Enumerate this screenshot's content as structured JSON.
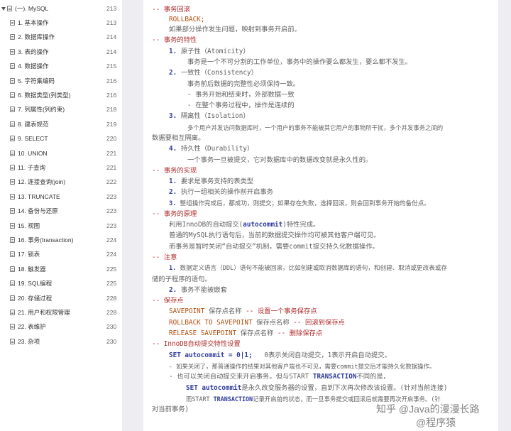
{
  "toc": {
    "root": {
      "label": "(一). MySQL",
      "page": "213"
    },
    "items": [
      {
        "label": "1. 基本操作",
        "page": "213"
      },
      {
        "label": "2. 数据库操作",
        "page": "214"
      },
      {
        "label": "3. 表的操作",
        "page": "214"
      },
      {
        "label": "4. 数据操作",
        "page": "215"
      },
      {
        "label": "5. 字符集编码",
        "page": "216"
      },
      {
        "label": "6. 数据类型(列类型)",
        "page": "216"
      },
      {
        "label": "7. 列属性(列约束)",
        "page": "218"
      },
      {
        "label": "8. 建表规范",
        "page": "219"
      },
      {
        "label": "9. SELECT",
        "page": "220"
      },
      {
        "label": "10. UNION",
        "page": "221"
      },
      {
        "label": "11. 子查询",
        "page": "221"
      },
      {
        "label": "12. 连接查询(join)",
        "page": "222"
      },
      {
        "label": "13. TRUNCATE",
        "page": "223"
      },
      {
        "label": "14. 备份与还原",
        "page": "223"
      },
      {
        "label": "15. 视图",
        "page": "223"
      },
      {
        "label": "16. 事务(transaction)",
        "page": "224"
      },
      {
        "label": "17. 锁表",
        "page": "224"
      },
      {
        "label": "18. 触发器",
        "page": "225"
      },
      {
        "label": "19. SQL编程",
        "page": "225"
      },
      {
        "label": "20. 存储过程",
        "page": "228"
      },
      {
        "label": "21. 用户和权限管理",
        "page": "228"
      },
      {
        "label": "22. 表维护",
        "page": "230"
      },
      {
        "label": "23. 杂项",
        "page": "230"
      }
    ]
  },
  "doc": {
    "l01": "-- 事务回滚",
    "l02": "ROLLBACK;",
    "l03": "如果部分操作发生问题，映射到事务开启前。",
    "l04": "-- 事务的特性",
    "l05a": "1.",
    "l05b": "原子性（Atomicity）",
    "l06": "事务是一个不可分割的工作单位，事务中的操作要么都发生，要么都不发生。",
    "l07a": "2.",
    "l07b": "一致性（Consistency）",
    "l08": "事务前后数据的完整性必须保持一致。",
    "l09": "- 事务开始和结束时，外部数据一致",
    "l10": "- 在整个事务过程中，操作是连续的",
    "l11a": "3.",
    "l11b": "隔离性（Isolation）",
    "l12": "多个用户并发访问数据库时，一个用户的事务不能被其它用户的事物所干扰，多个并发事务之间的",
    "l13": "数据要相互隔离。",
    "l14a": "4.",
    "l14b": "持久性（Durability）",
    "l15": "一个事务一旦被提交，它对数据库中的数据改变就是永久性的。",
    "l16": "-- 事务的实现",
    "l17a": "1.",
    "l17b": "要求是事务支持的表类型",
    "l18a": "2.",
    "l18b": "执行一组相关的操作前开启事务",
    "l19a": "3.",
    "l19b": "整组操作完成后，都成功，则提交；如果存在失败，选择回滚，则会回到事务开始的备份点。",
    "l20": "-- 事务的原理",
    "l21a": "利用InnoDB的自动提交(",
    "l21b": "autocommit",
    "l21c": ")特性完成。",
    "l22": "普通的MySQL执行语句后，当前的数据提交操作均可被其他客户端可见。",
    "l23": "而事务是暂时关闭“自动提交”机制，需要commit提交持久化数据操作。",
    "l24": "-- 注意",
    "l25a": "1.",
    "l25b": "数据定义语言（DDL）语句不能被回滚，比如创建或取消数据库的语句，和创建、取消或更改表或存",
    "l26": "储的子程序的语句。",
    "l27a": "2.",
    "l27b": "事务不能被嵌套",
    "l28": "-- 保存点",
    "l29a": "SAVEPOINT",
    "l29b": "保存点名称",
    "l29c": "-- 设置一个事务保存点",
    "l30a": "ROLLBACK TO SAVEPOINT",
    "l30b": "保存点名称",
    "l30c": "-- 回滚到保存点",
    "l31a": "RELEASE SAVEPOINT",
    "l31b": "保存点名称",
    "l31c": "-- 删除保存点",
    "l32": "-- InnoDB自动提交特性设置",
    "l33a": "SET autocommit",
    "l33b": "= 0|1;",
    "l33c": "0表示关闭自动提交，1表示开启自动提交。",
    "l34": "- 如果关闭了，那普通操作的结果对其他客户端也不可见，需要commit提交后才能持久化数据操作。",
    "l35a": "- 也可以关闭自动提交来开启事务。但与START",
    "l35b": "TRANSACTION",
    "l35c": "不同的是，",
    "l36a": "SET autocommit",
    "l36b": "是永久改变服务器的设置，直到下次再次修改该设置。(针对当前连接)",
    "l37a": "而START",
    "l37b": "TRANSACTION",
    "l37c": "记录开启前的状态，而一旦事务提交或回滚后就需要再次开启事务。(针",
    "l38": "对当前事务)"
  },
  "watermark": {
    "line1": "知乎 @Java的漫漫长路",
    "line2": "@程序猿"
  }
}
